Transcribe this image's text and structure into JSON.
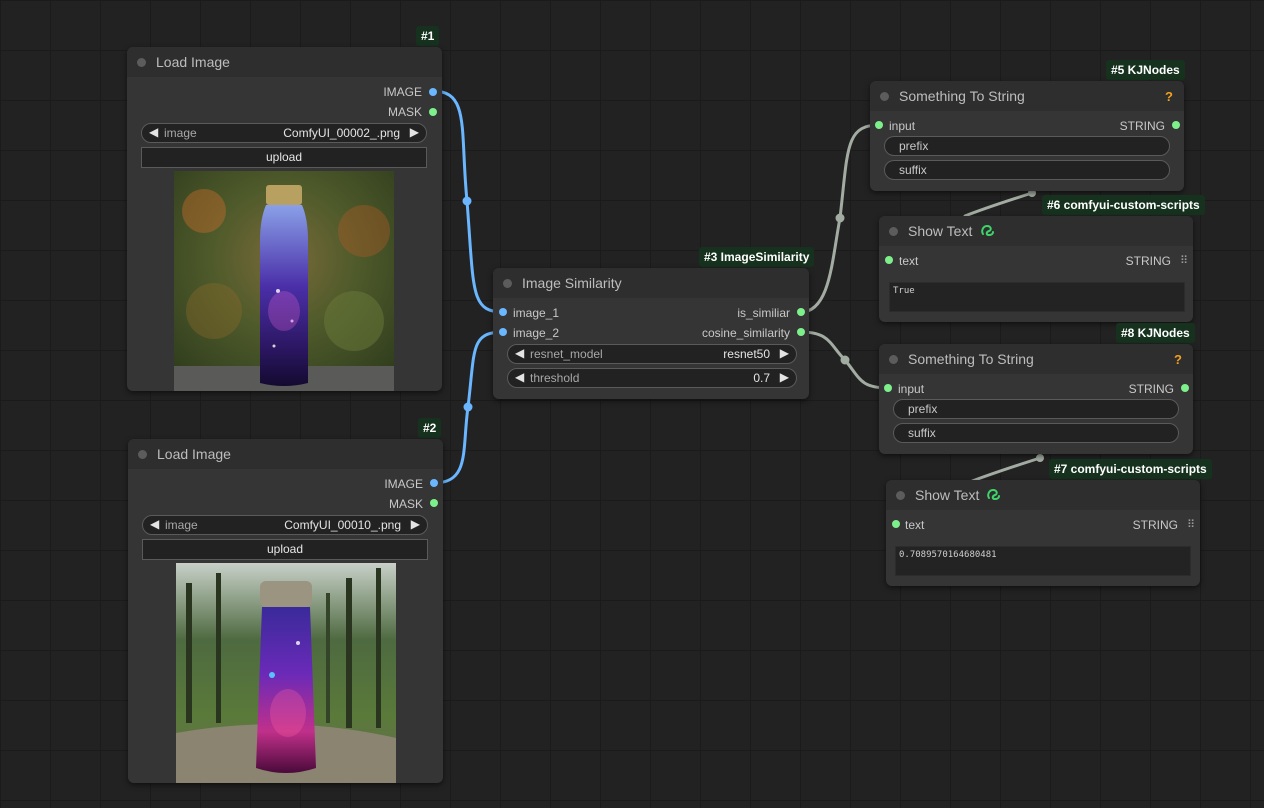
{
  "colors": {
    "image_wire": "#6ab6ff",
    "string_wire": "#a3aca3",
    "badge_bg": "#16321e",
    "output_green": "#7ef08b"
  },
  "nodes": {
    "load_image_1": {
      "badge": "#1",
      "title": "Load Image",
      "outputs": [
        "IMAGE",
        "MASK"
      ],
      "image_widget": {
        "label": "image",
        "value": "ComfyUI_00002_.png"
      },
      "upload_label": "upload",
      "preview_icon": "bottle-preview-image"
    },
    "load_image_2": {
      "badge": "#2",
      "title": "Load Image",
      "outputs": [
        "IMAGE",
        "MASK"
      ],
      "image_widget": {
        "label": "image",
        "value": "ComfyUI_00010_.png"
      },
      "upload_label": "upload",
      "preview_icon": "bottle-preview-image"
    },
    "image_similarity": {
      "badge": "#3 ImageSimilarity",
      "title": "Image Similarity",
      "inputs": [
        "image_1",
        "image_2"
      ],
      "outputs": [
        "is_similiar",
        "cosine_similarity"
      ],
      "widgets": [
        {
          "label": "resnet_model",
          "value": "resnet50"
        },
        {
          "label": "threshold",
          "value": "0.7"
        }
      ]
    },
    "something_to_string_5": {
      "badge": "#5 KJNodes",
      "title": "Something To String",
      "input": "input",
      "output": "STRING",
      "fields": [
        "prefix",
        "suffix"
      ],
      "help": "?"
    },
    "show_text_6": {
      "badge": "#6 comfyui-custom-scripts",
      "title": "Show Text",
      "title_icon": "custom-scripts-snake-icon",
      "input": "text",
      "output": "STRING",
      "text_value": "True"
    },
    "something_to_string_8": {
      "badge": "#8 KJNodes",
      "title": "Something To String",
      "input": "input",
      "output": "STRING",
      "fields": [
        "prefix",
        "suffix"
      ],
      "help": "?"
    },
    "show_text_7": {
      "badge": "#7 comfyui-custom-scripts",
      "title": "Show Text",
      "title_icon": "custom-scripts-snake-icon",
      "input": "text",
      "output": "STRING",
      "text_value": "0.7089570164680481"
    }
  }
}
